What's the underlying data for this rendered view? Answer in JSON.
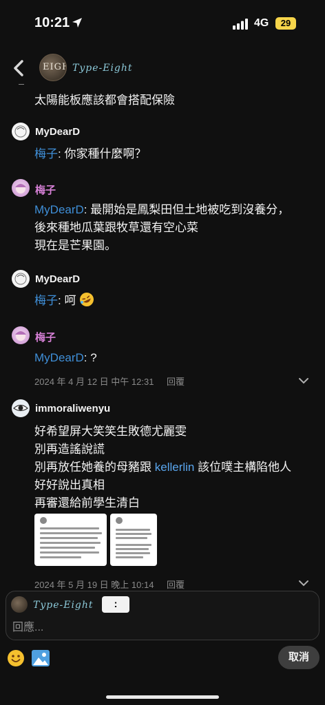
{
  "status": {
    "time": "10:21",
    "network": "4G",
    "battery": "29"
  },
  "header": {
    "name": "Type-Eight",
    "avatar_text": "EIGHT"
  },
  "post": {
    "text": "太陽能板應該都會搭配保險"
  },
  "thread": [
    {
      "user": "MyDearD",
      "mention": "梅子",
      "text": ": 你家種什麼啊？"
    },
    {
      "user": "梅子",
      "mention": "MyDearD",
      "lines": [
        ": 最開始是鳳梨田但土地被吃到沒養分，",
        "後來種地瓜葉跟牧草還有空心菜",
        "現在是芒果園。"
      ]
    },
    {
      "user": "MyDearD",
      "mention": "梅子",
      "text": ": 呵"
    },
    {
      "user": "梅子",
      "mention": "MyDearD",
      "text": ": ?"
    }
  ],
  "meta1": {
    "date": "2024 年 4 月 12 日 中午 12:31",
    "reply_label": "回覆"
  },
  "comment2": {
    "user": "immoraliwenyu",
    "line1": "好希望屏大笑笑生敗德尤麗雯",
    "line2": "別再造謠說謊",
    "line3_pre": "別再放任她養的母豬跟 ",
    "line3_mention": "kellerlin",
    "line3_post": " 該位噗主構陷他人",
    "line4": "好好說出真相",
    "line5": "再審還給前學生清白"
  },
  "meta2": {
    "date": "2024 年 5 月 19 日 晚上 10:14",
    "reply_label": "回覆"
  },
  "reply_bar": {
    "name": "Type-Eight",
    "colon": ":",
    "placeholder": "回應...",
    "cancel_label": "取消"
  },
  "colors": {
    "background": "#101010",
    "mention": "#3f8fd8",
    "pink_name": "#d680d6",
    "battery": "#f7d54a"
  }
}
